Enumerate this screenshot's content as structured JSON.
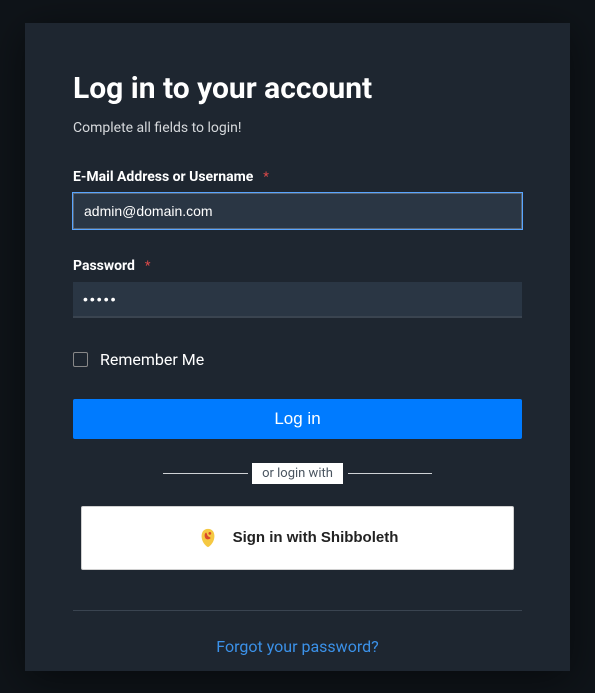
{
  "title": "Log in to your account",
  "subtitle": "Complete all fields to login!",
  "email": {
    "label": "E-Mail Address or Username",
    "value": "admin@domain.com"
  },
  "password": {
    "label": "Password",
    "value": "•••••"
  },
  "remember_label": "Remember Me",
  "login_button": "Log in",
  "divider_text": "or login with",
  "sso_button": "Sign in with Shibboleth",
  "forgot_link": "Forgot your password?"
}
